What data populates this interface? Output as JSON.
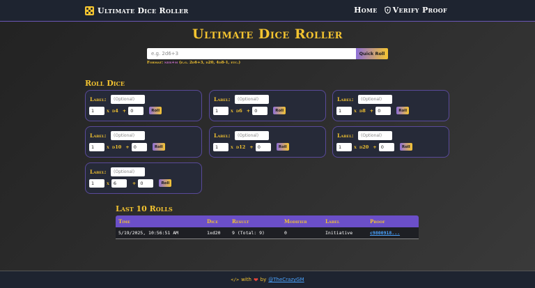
{
  "nav": {
    "brand": "Ultimate Dice Roller",
    "links": [
      {
        "label": "Home"
      },
      {
        "label": "Verify Proof"
      }
    ]
  },
  "main": {
    "title": "Ultimate Dice Roller",
    "quick_roll": {
      "placeholder": "e.g. 2d6+3",
      "button_label": "Quick Roll",
      "format_prefix": "Format: ",
      "format_code": "ndx+m",
      "format_examples": "(e.g. 2d6+3, d20, 4d8-1, etc.)"
    }
  },
  "roll_dice": {
    "heading": "Roll Dice",
    "label_text": "Label:",
    "label_placeholder": "(Optional)",
    "roll_label": "Roll",
    "x_text": "x",
    "plus_text": "+",
    "cards": [
      {
        "count": "1",
        "die": "d4",
        "modifier": "0"
      },
      {
        "count": "1",
        "die": "d6",
        "modifier": "0"
      },
      {
        "count": "1",
        "die": "d8",
        "modifier": "0"
      },
      {
        "count": "1",
        "die": "d10",
        "modifier": "0"
      },
      {
        "count": "1",
        "die": "d12",
        "modifier": "0"
      },
      {
        "count": "1",
        "die": "d20",
        "modifier": "0"
      },
      {
        "count": "1",
        "sides": "6",
        "modifier": "0"
      }
    ]
  },
  "history": {
    "heading": "Last 10 Rolls",
    "columns": [
      "Time",
      "Dice",
      "Result",
      "Modifier",
      "Label",
      "Proof"
    ],
    "rows": [
      {
        "time": "5/19/2025, 10:56:51 AM",
        "dice": "1xd20",
        "result": "9 (Total: 9)",
        "modifier": "0",
        "label": "Initiative",
        "proof": "c9800918..."
      }
    ]
  },
  "footer": {
    "code_glyph": "</>",
    "with_text": "with",
    "by_text": "by",
    "author": "@TheCrazyGM"
  },
  "colors": {
    "accent_gold": "#f4c430",
    "accent_purple": "#6b4fc8",
    "link_blue": "#4aa3ff",
    "heart_red": "#e8453c"
  }
}
